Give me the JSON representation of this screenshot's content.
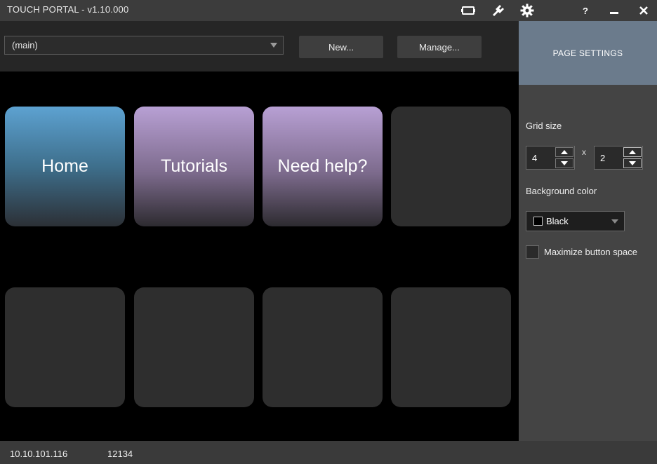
{
  "window": {
    "title": "TOUCH PORTAL - v1.10.000",
    "icons": [
      "device-icon",
      "plug-icon",
      "gear-icon",
      "help-icon",
      "minimize-icon",
      "close-icon"
    ],
    "help_label": "?"
  },
  "toolbar": {
    "page_select_value": "(main)",
    "new_label": "New...",
    "manage_label": "Manage..."
  },
  "grid": {
    "buttons": [
      {
        "label": "Home",
        "color": "#5da2d1"
      },
      {
        "label": "Tutorials",
        "color": "#b8a0d4"
      },
      {
        "label": "Need help?",
        "color": "#b8a0d4"
      },
      {
        "label": ""
      },
      {
        "label": ""
      },
      {
        "label": ""
      },
      {
        "label": ""
      },
      {
        "label": ""
      }
    ]
  },
  "page_settings": {
    "header": "PAGE SETTINGS",
    "grid_size_label": "Grid size",
    "grid_columns": "4",
    "grid_separator": "x",
    "grid_rows": "2",
    "background_color_label": "Background color",
    "background_color_value": "Black",
    "maximize_label": "Maximize button space",
    "maximize_checked": false
  },
  "status": {
    "ip": "10.10.101.116",
    "port": "12134"
  },
  "colors": {
    "titlebar": "#3c3c3c",
    "panel_header": "#6b7b8c",
    "panel": "#444444",
    "tile_empty": "#2e2e2e"
  }
}
